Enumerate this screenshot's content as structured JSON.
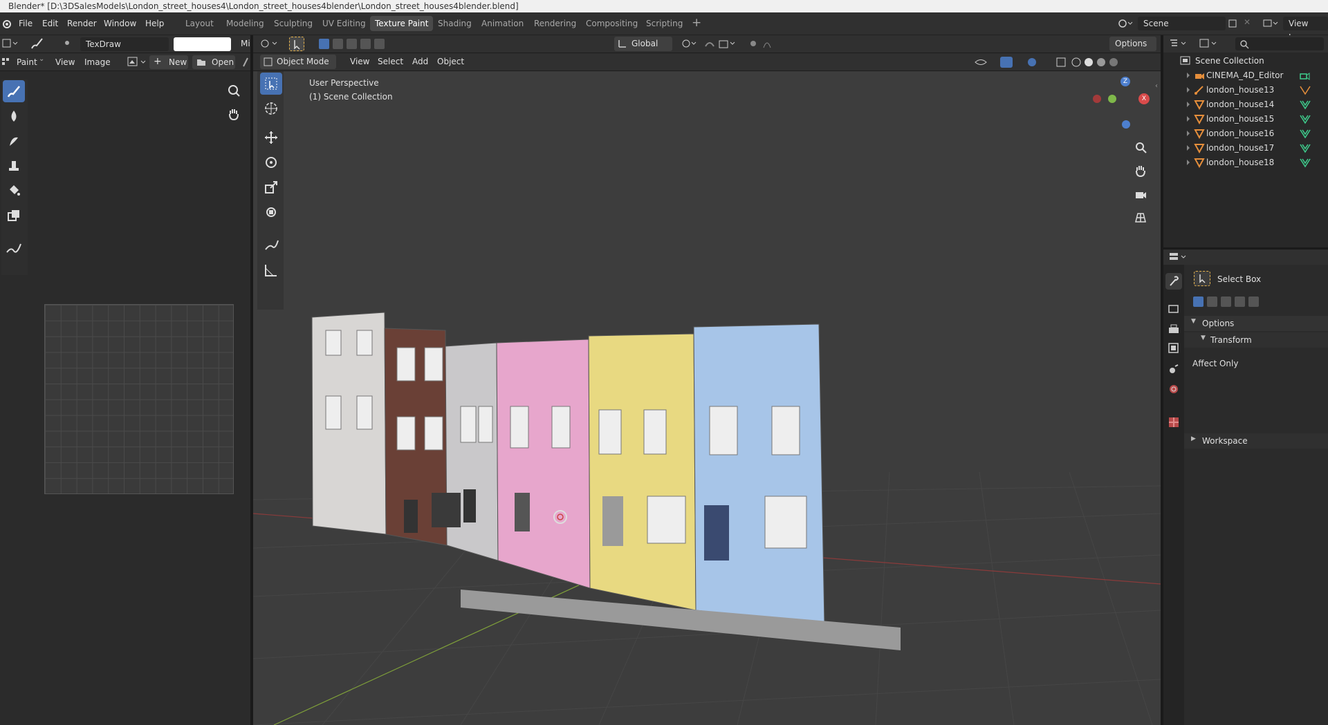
{
  "window": {
    "title": "Blender* [D:\\3DSalesModels\\London_street_houses4\\London_street_houses4blender\\London_street_houses4blender.blend]"
  },
  "menu": [
    "File",
    "Edit",
    "Render",
    "Window",
    "Help"
  ],
  "workspaces": [
    "Layout",
    "Modeling",
    "Sculpting",
    "UV Editing",
    "Texture Paint",
    "Shading",
    "Animation",
    "Rendering",
    "Compositing",
    "Scripting"
  ],
  "active_workspace": "Texture Paint",
  "scene": {
    "name": "Scene",
    "view_layer": "View Layer"
  },
  "image_editor": {
    "brush_name": "TexDraw",
    "mode_cut": "Mi",
    "mode": "Paint",
    "view_menu": "View",
    "image_menu": "Image",
    "new_label": "New",
    "open_label": "Open"
  },
  "viewport": {
    "transform_orientation": "Global",
    "options_label": "Options",
    "mode": "Object Mode",
    "menus": [
      "View",
      "Select",
      "Add",
      "Object"
    ],
    "overlay_line1": "User Perspective",
    "overlay_line2": "(1) Scene Collection",
    "gizmo": {
      "z": "Z",
      "x": "X"
    }
  },
  "outliner": {
    "root": "Scene Collection",
    "items": [
      {
        "name": "CINEMA_4D_Editor",
        "icon": "camera-icon"
      },
      {
        "name": "london_house13",
        "icon": "armature-icon"
      },
      {
        "name": "london_house14",
        "icon": "mesh-icon"
      },
      {
        "name": "london_house15",
        "icon": "mesh-icon"
      },
      {
        "name": "london_house16",
        "icon": "mesh-icon"
      },
      {
        "name": "london_house17",
        "icon": "mesh-icon"
      },
      {
        "name": "london_house18",
        "icon": "mesh-icon"
      }
    ]
  },
  "properties": {
    "tool": "Select Box",
    "options": "Options",
    "transform": "Transform",
    "affect_only": "Affect Only",
    "workspace": "Workspace"
  },
  "colors": {
    "accent": "#4772b3",
    "panel": "#303030",
    "viewport": "#3d3d3d",
    "object_orange": "#e58e3b",
    "mesh_green": "#3fcf8e"
  },
  "houses": [
    {
      "color": "#d8d6d4"
    },
    {
      "color": "#6a4036"
    },
    {
      "color": "#c9c8ca"
    },
    {
      "color": "#e7a6cc"
    },
    {
      "color": "#e8d981"
    },
    {
      "color": "#a7c5e8"
    }
  ]
}
